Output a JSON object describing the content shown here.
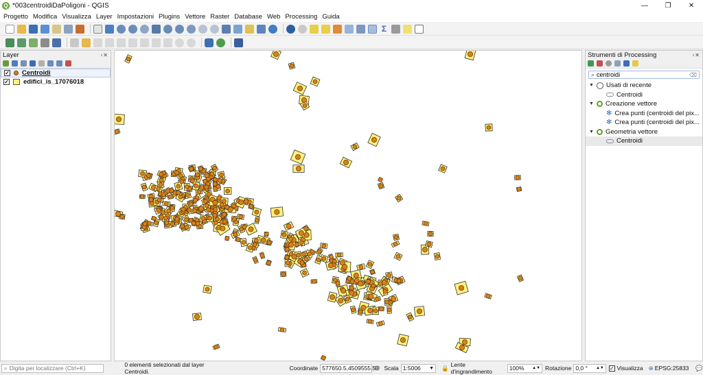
{
  "window": {
    "title": "*003centroidiDaPoligoni - QGIS",
    "min": "—",
    "max": "❐",
    "close": "✕"
  },
  "menu": [
    "Progetto",
    "Modifica",
    "Visualizza",
    "Layer",
    "Impostazioni",
    "Plugins",
    "Vettore",
    "Raster",
    "Database",
    "Web",
    "Processing",
    "Guida"
  ],
  "layers_panel": {
    "title": "Layer",
    "layers": [
      {
        "name": "Centroidi",
        "checked": true,
        "symbol": "point",
        "selected": true
      },
      {
        "name": "edifici_is_17076018",
        "checked": true,
        "symbol": "polygon",
        "selected": false
      }
    ]
  },
  "processing_panel": {
    "title": "Strumenti di Processing",
    "search_value": "centroidi",
    "tree": [
      {
        "level": 0,
        "arrow": "▼",
        "icon": "clock",
        "label": "Usati di recente"
      },
      {
        "level": 1,
        "icon": "algorithm",
        "label": "Centroidi"
      },
      {
        "level": 0,
        "arrow": "▼",
        "icon": "qgis",
        "label": "Creazione vettore"
      },
      {
        "level": 1,
        "icon": "gear",
        "label": "Crea punti (centroidi del pix..."
      },
      {
        "level": 1,
        "icon": "gear",
        "label": "Crea punti (centroidi del pix..."
      },
      {
        "level": 0,
        "arrow": "▼",
        "icon": "qgis",
        "label": "Geometria vettore"
      },
      {
        "level": 1,
        "icon": "algorithm",
        "label": "Centroidi",
        "highlighted": true
      }
    ]
  },
  "status": {
    "locator_placeholder": "Digita per localizzare (Ctrl+K)",
    "selection_msg": "0 elementi selezionati dal layer Centroidi.",
    "coord_label": "Coordinate",
    "coord_value": "577650.5,4509555.5",
    "scale_label": "Scala",
    "scale_value": "1:5006",
    "magnifier_label": "Lente d'ingrandimento",
    "magnifier_value": "100%",
    "rotation_label": "Rotazione",
    "rotation_value": "0,0 °",
    "render_label": "Visualizza",
    "crs": "EPSG:25833"
  },
  "colors": {
    "polygon_fill": "#fff27a",
    "point_fill": "#d9821e",
    "point_stroke": "#6b3d06"
  }
}
